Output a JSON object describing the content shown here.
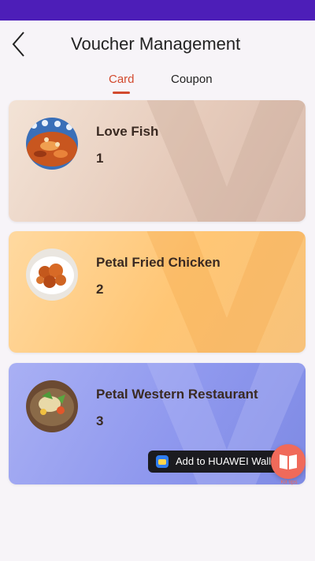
{
  "header": {
    "title": "Voucher Management"
  },
  "tabs": [
    {
      "label": "Card",
      "active": true
    },
    {
      "label": "Coupon",
      "active": false
    }
  ],
  "cards": [
    {
      "name": "Love Fish",
      "count": "1"
    },
    {
      "name": "Petal Fried Chicken",
      "count": "2"
    },
    {
      "name": "Petal Western Restaurant",
      "count": "3"
    }
  ],
  "wallet": {
    "label": "Add to HUAWEI Wall"
  },
  "fab": {
    "label": "Kit tips"
  },
  "colors": {
    "accent": "#d24a2e",
    "status_bar": "#4d1eb8",
    "card_1": "#e6cbbb",
    "card_2": "#ffc675",
    "card_3": "#8f98ee",
    "fab": "#f06a5a"
  }
}
